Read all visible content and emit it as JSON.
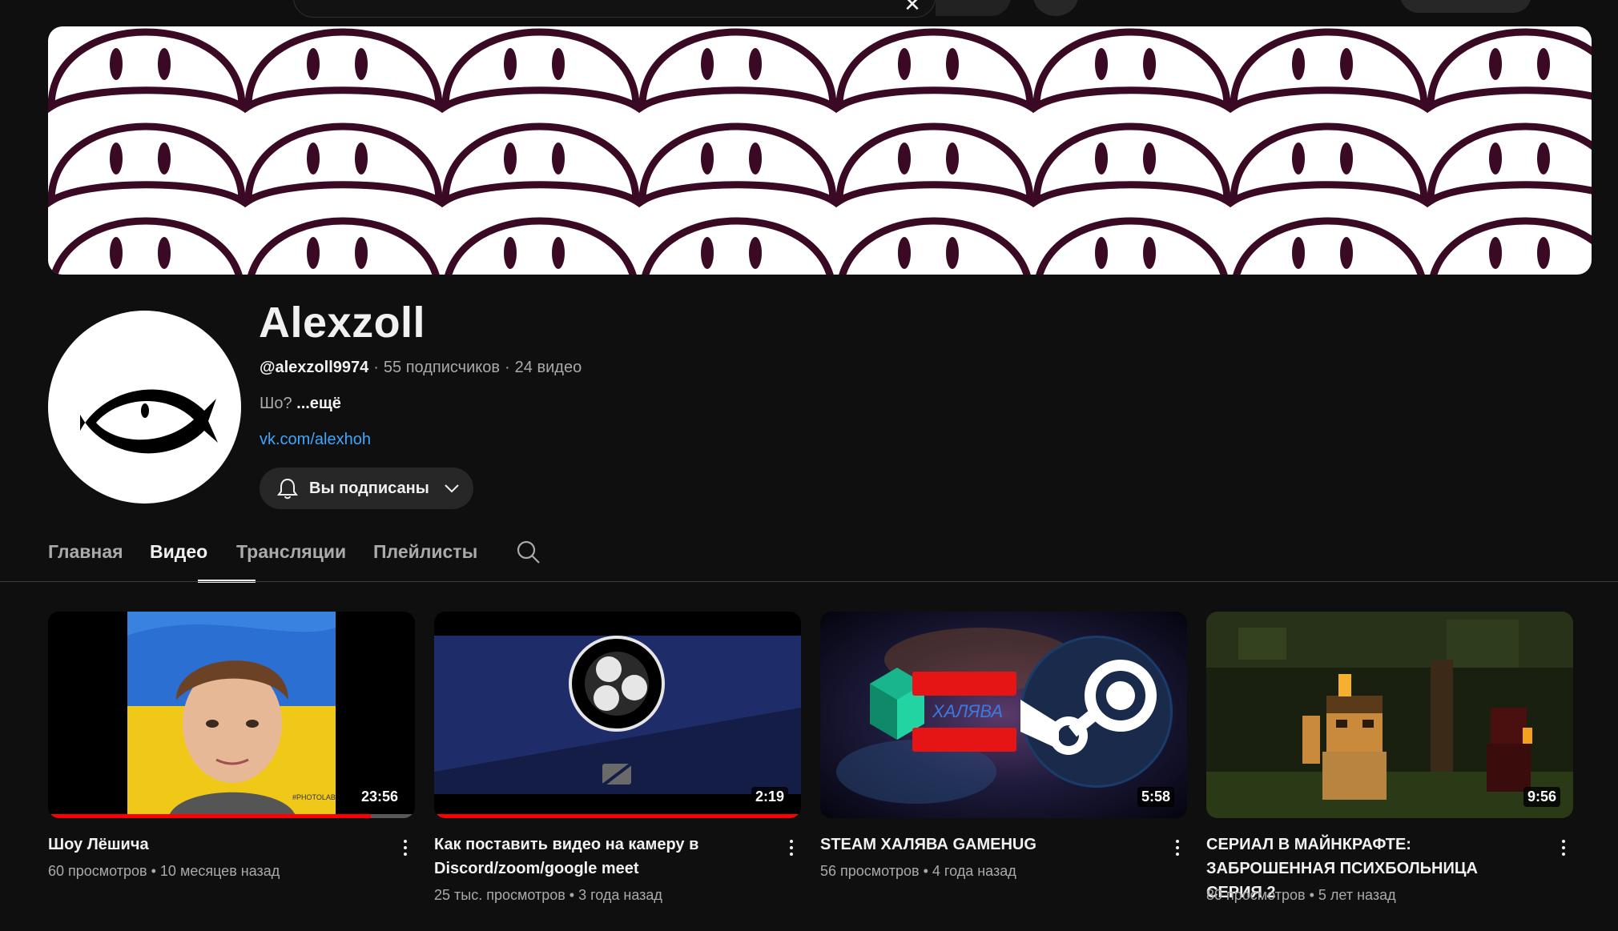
{
  "channel": {
    "name": "Alexzoll",
    "handle": "@alexzoll9974",
    "subscribers": "55 подписчиков",
    "videos_count": "24 видео",
    "description": "Шо?",
    "more": "...ещё",
    "link": "vk.com/alexhoh",
    "subscribe_label": "Вы подписаны"
  },
  "tabs": [
    "Главная",
    "Видео",
    "Трансляции",
    "Плейлисты"
  ],
  "active_tab": "Видео",
  "videos": [
    {
      "title": "Шоу Лёшича",
      "views": "60 просмотров",
      "age": "10 месяцев назад",
      "duration": "23:56",
      "watched_progress": 0.88,
      "thumb_text": "#PHOTOLAB"
    },
    {
      "title": "Как поставить видео на камеру в Discord/zoom/google meet",
      "views": "25 тыс. просмотров",
      "age": "3 года назад",
      "duration": "2:19",
      "watched_progress": 1.0
    },
    {
      "title": "STEAM ХАЛЯВА GAMEHUG",
      "views": "56 просмотров",
      "age": "4 года назад",
      "duration": "5:58",
      "thumb_text": "ХАЛЯВА"
    },
    {
      "title": "СЕРИАЛ В МАЙНКРАФТЕ: ЗАБРОШЕННАЯ ПСИХБОЛЬНИЦА СЕРИЯ 2",
      "views": "80 просмотров",
      "age": "5 лет назад",
      "duration": "9:56"
    }
  ],
  "colors": {
    "background": "#0f0f0f",
    "link": "#3ea6ff",
    "banner_pattern": "#3a0a24",
    "progress": "#ff0000"
  },
  "icons": [
    "search-icon",
    "close-icon",
    "mic-icon",
    "bell-icon",
    "chevron-down-icon",
    "more-vert-icon"
  ]
}
